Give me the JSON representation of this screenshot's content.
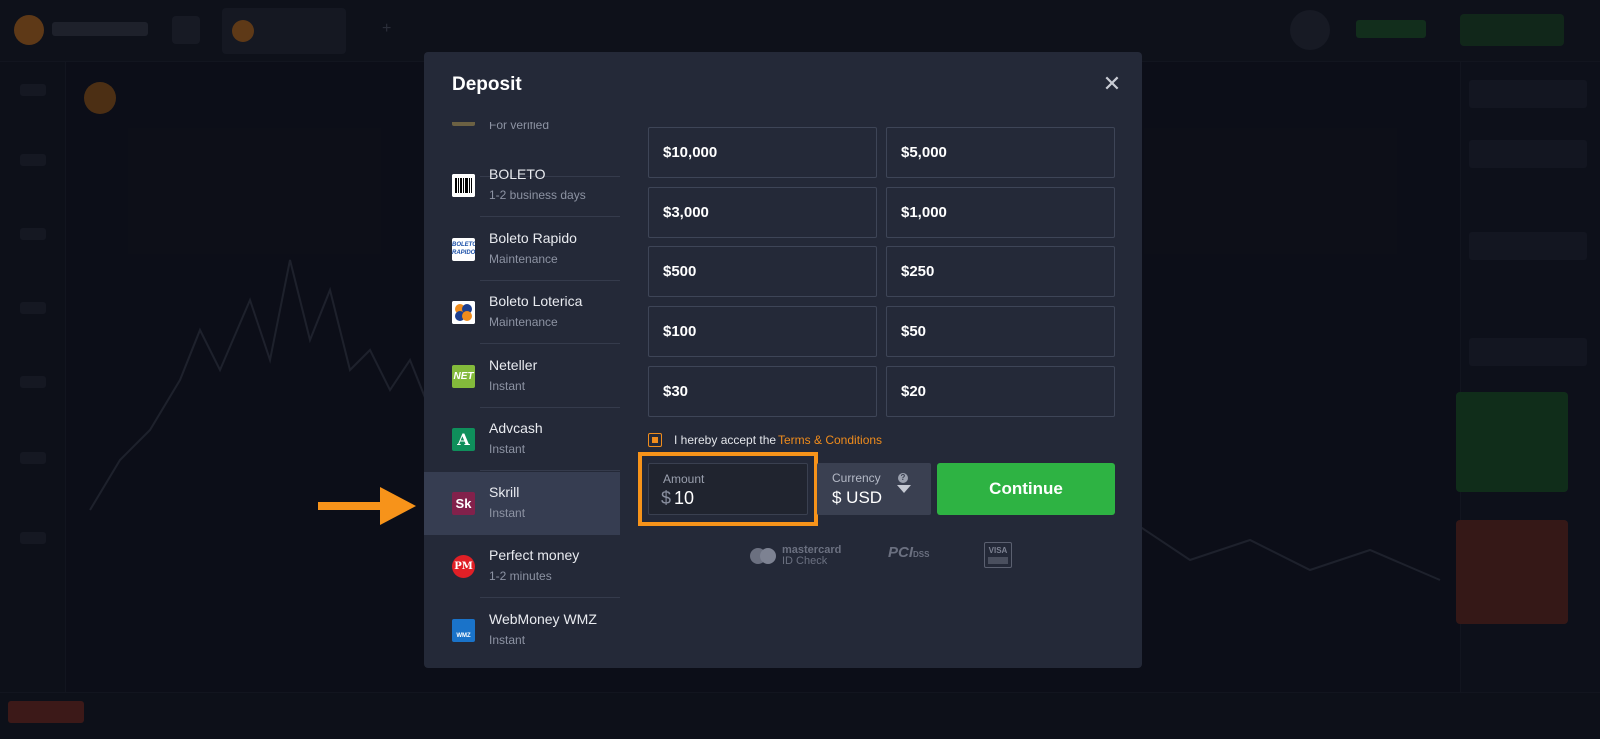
{
  "modal": {
    "title": "Deposit",
    "close_icon": "close-icon"
  },
  "payment_methods": [
    {
      "name": "",
      "sub": "For verified",
      "icon": "card-icon"
    },
    {
      "name": "BOLETO",
      "sub": "1-2 business days",
      "icon": "barcode-icon"
    },
    {
      "name": "Boleto Rapido",
      "sub": "Maintenance",
      "icon": "boleto-rapido-icon",
      "icon_text": "BOLETO RAPIDO"
    },
    {
      "name": "Boleto Loterica",
      "sub": "Maintenance",
      "icon": "clover-icon"
    },
    {
      "name": "Neteller",
      "sub": "Instant",
      "icon": "neteller-icon",
      "icon_text": "NET"
    },
    {
      "name": "Advcash",
      "sub": "Instant",
      "icon": "advcash-icon",
      "icon_text": "A"
    },
    {
      "name": "Skrill",
      "sub": "Instant",
      "icon": "skrill-icon",
      "icon_text": "Sk",
      "selected": true
    },
    {
      "name": "Perfect money",
      "sub": "1-2 minutes",
      "icon": "perfect-money-icon",
      "icon_text": "PM"
    },
    {
      "name": "WebMoney WMZ",
      "sub": "Instant",
      "icon": "webmoney-icon",
      "icon_text": "WMZ"
    }
  ],
  "amounts": [
    "$10,000",
    "$5,000",
    "$3,000",
    "$1,000",
    "$500",
    "$250",
    "$100",
    "$50",
    "$30",
    "$20"
  ],
  "terms": {
    "checked": true,
    "text": "I hereby accept the",
    "link": "Terms & Conditions"
  },
  "amount_field": {
    "label": "Amount",
    "symbol": "$",
    "value": "10"
  },
  "currency": {
    "label": "Currency",
    "help": "?",
    "value": "$ USD"
  },
  "continue_label": "Continue",
  "badges": {
    "mastercard_line1": "mastercard",
    "mastercard_line2": "ID Check",
    "pci": "PCI",
    "pci_sub": "DSS",
    "visa": "VISA"
  },
  "colors": {
    "accent_orange": "#f7931a",
    "continue_green": "#2eb343",
    "modal_bg": "#242938"
  }
}
